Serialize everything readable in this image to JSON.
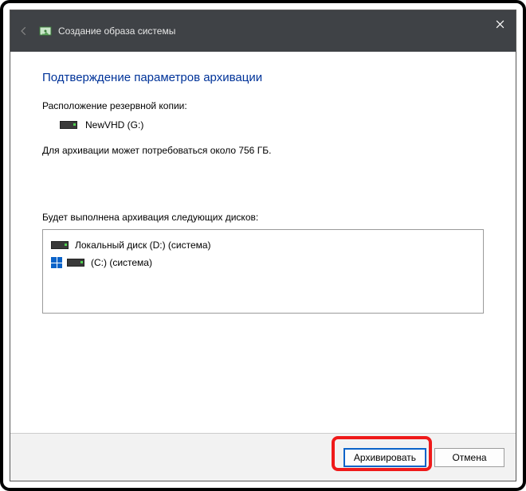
{
  "titlebar": {
    "title": "Создание образа системы"
  },
  "content": {
    "heading": "Подтверждение параметров архивации",
    "location_label": "Расположение резервной копии:",
    "location_value": "NewVHD (G:)",
    "size_text": "Для архивации может потребоваться около 756 ГБ.",
    "drives_label": "Будет выполнена архивация следующих дисков:",
    "drives": [
      {
        "label": "Локальный диск (D:) (система)",
        "has_win_flag": false
      },
      {
        "label": "(C:) (система)",
        "has_win_flag": true
      }
    ]
  },
  "footer": {
    "primary": "Архивировать",
    "cancel": "Отмена"
  }
}
